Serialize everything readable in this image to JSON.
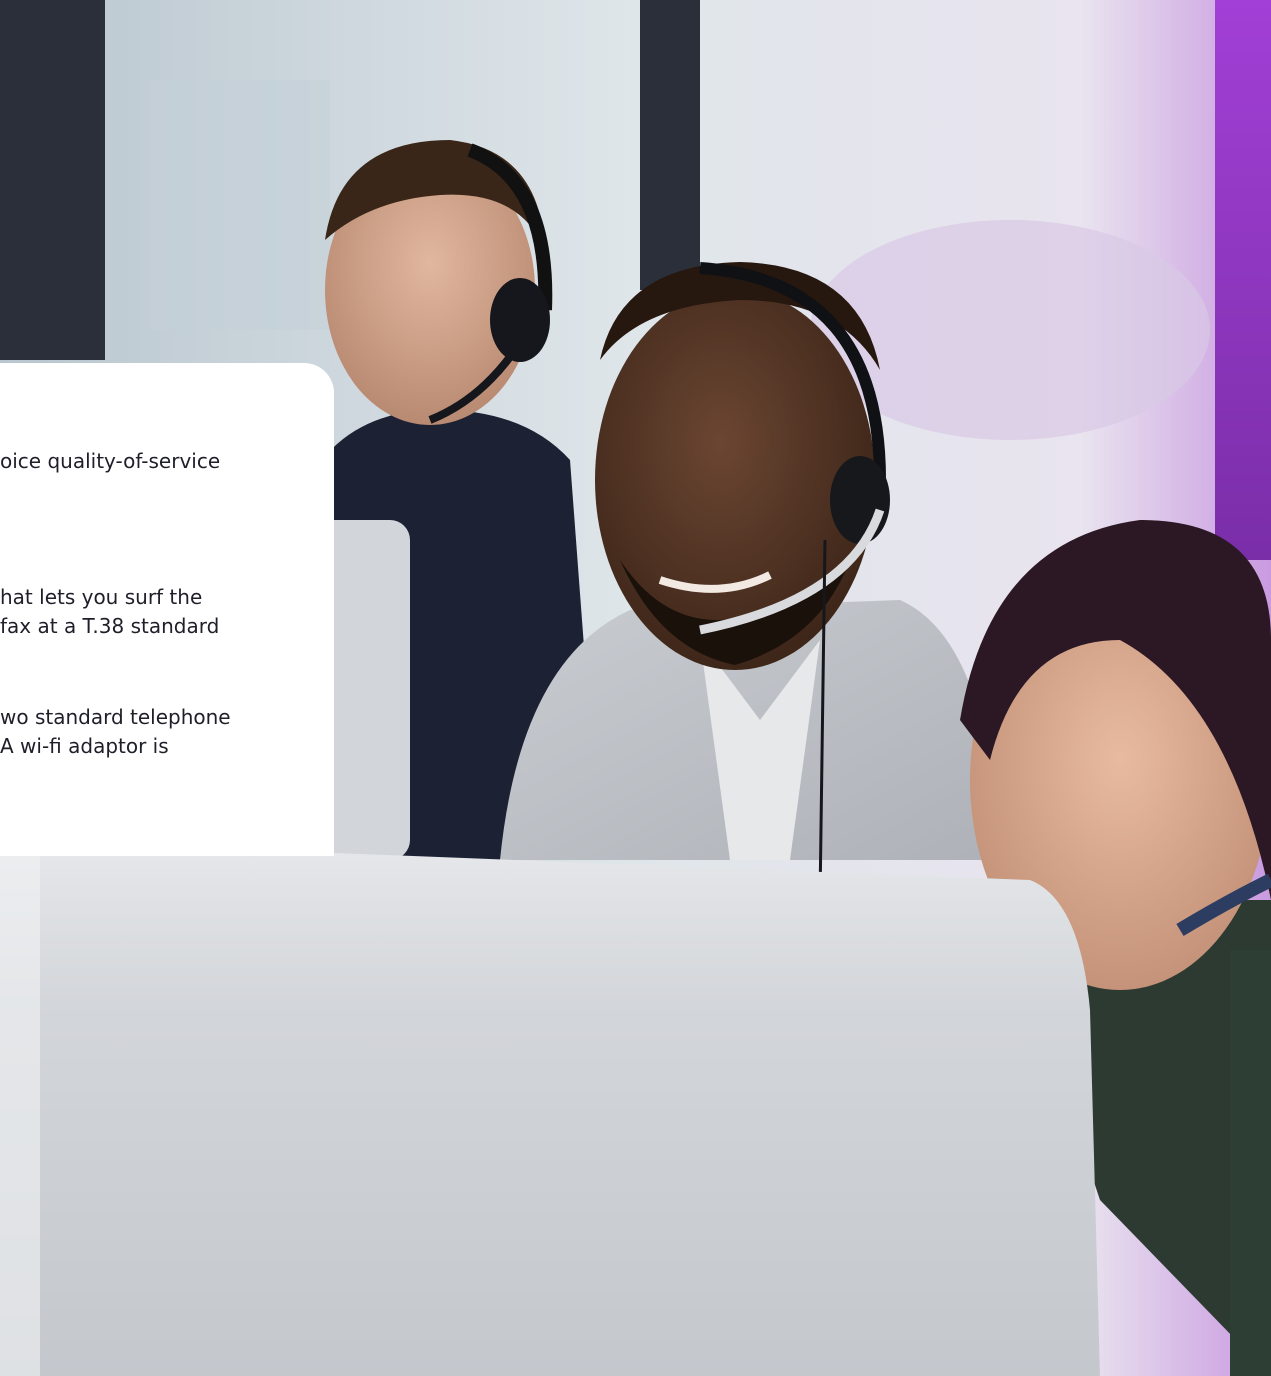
{
  "text_card": {
    "features": [
      {
        "lines": [
          "oice quality-of-service"
        ]
      },
      {
        "lines": [
          "hat lets you surf the",
          "fax at a  T.38 standard"
        ]
      },
      {
        "lines": [
          "wo standard telephone",
          "A wi-fi adaptor is"
        ]
      }
    ]
  },
  "photo": {
    "subject": "call-centre agents wearing headsets",
    "colors": {
      "purple_accent": "#9b3fd0",
      "window_frame": "#2a2f3a",
      "monitor": "#d4d8de"
    }
  }
}
